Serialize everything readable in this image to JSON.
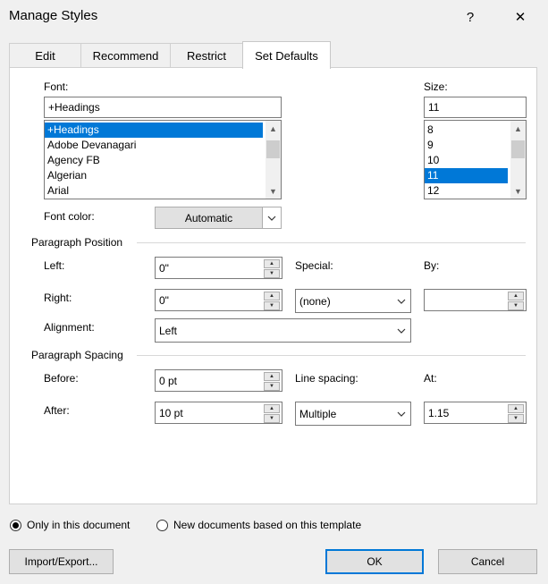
{
  "window": {
    "title": "Manage Styles",
    "help_label": "?",
    "close_label": "✕"
  },
  "tabs": [
    {
      "label": "Edit"
    },
    {
      "label": "Recommend"
    },
    {
      "label": "Restrict"
    },
    {
      "label": "Set Defaults",
      "active": true
    }
  ],
  "font": {
    "label": "Font:",
    "value": "+Headings",
    "items": [
      "+Headings",
      "Adobe Devanagari",
      "Agency FB",
      "Algerian",
      "Arial"
    ],
    "selected_index": 0
  },
  "size": {
    "label": "Size:",
    "value": "11",
    "items": [
      "8",
      "9",
      "10",
      "11",
      "12"
    ],
    "selected_index": 3
  },
  "font_color": {
    "label": "Font color:",
    "value": "Automatic"
  },
  "paragraph_position": {
    "heading": "Paragraph Position",
    "left_label": "Left:",
    "left_value": "0\"",
    "right_label": "Right:",
    "right_value": "0\"",
    "special_label": "Special:",
    "special_value": "(none)",
    "by_label": "By:",
    "by_value": "",
    "alignment_label": "Alignment:",
    "alignment_value": "Left"
  },
  "paragraph_spacing": {
    "heading": "Paragraph Spacing",
    "before_label": "Before:",
    "before_value": "0 pt",
    "after_label": "After:",
    "after_value": "10 pt",
    "line_spacing_label": "Line spacing:",
    "line_spacing_value": "Multiple",
    "at_label": "At:",
    "at_value": "1.15"
  },
  "scope": {
    "option1": "Only in this document",
    "option2": "New documents based on this template",
    "selected": "option1"
  },
  "buttons": {
    "import_export": "Import/Export...",
    "ok": "OK",
    "cancel": "Cancel"
  },
  "colors": {
    "accent": "#0078d7",
    "dialog_bg": "#f0f0f0"
  }
}
